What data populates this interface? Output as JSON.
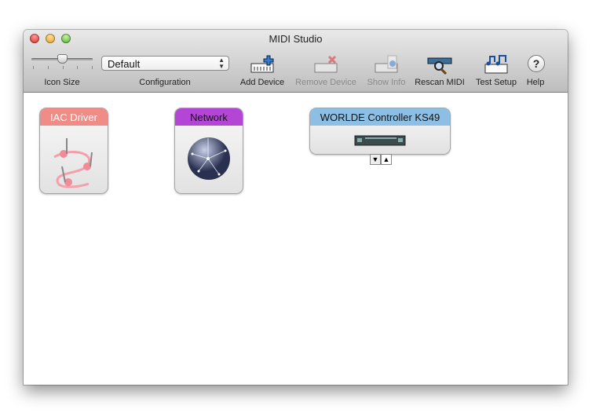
{
  "window": {
    "title": "MIDI Studio"
  },
  "toolbar": {
    "icon_size_label": "Icon Size",
    "icon_size_level": 0.5,
    "configuration_label": "Configuration",
    "configuration_value": "Default",
    "add_device": "Add Device",
    "remove_device": "Remove Device",
    "show_info": "Show Info",
    "rescan_midi": "Rescan MIDI",
    "test_setup": "Test Setup",
    "help": "Help",
    "help_glyph": "?"
  },
  "devices": [
    {
      "name": "IAC Driver",
      "color": "#f08c88",
      "icon": "music-notes-icon"
    },
    {
      "name": "Network",
      "color": "#b446d6",
      "icon": "globe-network-icon"
    },
    {
      "name": "WORLDE Controller KS49",
      "color": "#8cbfe3",
      "icon": "keyboard-controller-icon"
    }
  ],
  "ports": {
    "down": "▼",
    "up": "▲"
  }
}
